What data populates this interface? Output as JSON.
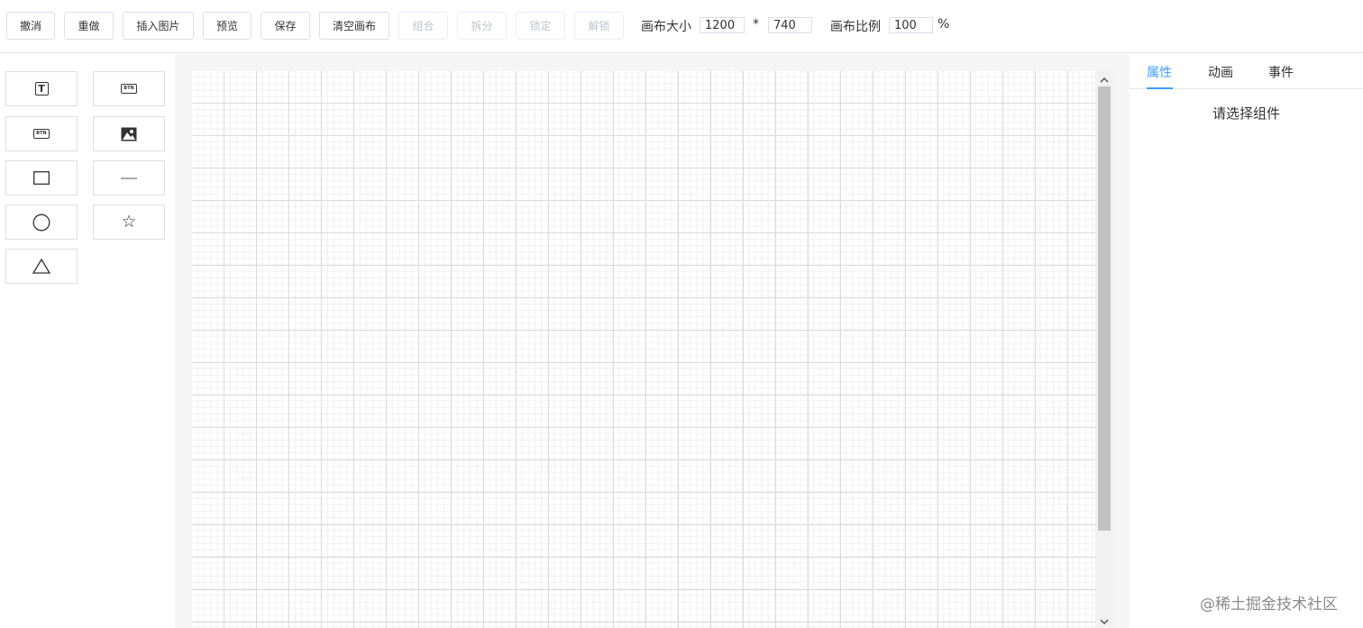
{
  "toolbar": {
    "buttons": [
      {
        "label": "撤消",
        "enabled": true
      },
      {
        "label": "重做",
        "enabled": true
      },
      {
        "label": "插入图片",
        "enabled": true
      },
      {
        "label": "预览",
        "enabled": true
      },
      {
        "label": "保存",
        "enabled": true
      },
      {
        "label": "清空画布",
        "enabled": true
      },
      {
        "label": "组合",
        "enabled": false
      },
      {
        "label": "拆分",
        "enabled": false
      },
      {
        "label": "锁定",
        "enabled": false
      },
      {
        "label": "解锁",
        "enabled": false
      }
    ],
    "canvas_size_label": "画布大小",
    "canvas_width": "1200",
    "times_sign": "*",
    "canvas_height": "740",
    "canvas_scale_label": "画布比例",
    "canvas_scale": "100",
    "percent_sign": "%"
  },
  "components": {
    "text_icon_glyph": "T",
    "button_icon_text": "BTN",
    "button2_icon_text": "BTN",
    "star_glyph": "☆"
  },
  "right_panel": {
    "tabs": [
      {
        "label": "属性",
        "active": true
      },
      {
        "label": "动画",
        "active": false
      },
      {
        "label": "事件",
        "active": false
      }
    ],
    "placeholder": "请选择组件"
  },
  "watermark": "@稀土掘金技术社区",
  "colors": {
    "accent": "#409eff",
    "border": "#dcdfe6",
    "disabled_text": "#c0c4cc"
  }
}
